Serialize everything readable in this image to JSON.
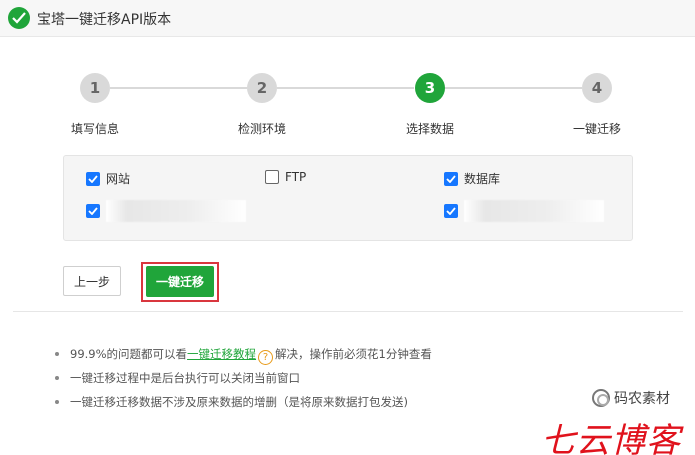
{
  "window": {
    "title": "宝塔一键迁移API版本"
  },
  "steps": [
    {
      "number": "1",
      "label": "填写信息",
      "state": "done"
    },
    {
      "number": "2",
      "label": "检测环境",
      "state": "done"
    },
    {
      "number": "3",
      "label": "选择数据",
      "state": "active"
    },
    {
      "number": "4",
      "label": "一键迁移",
      "state": "pending"
    }
  ],
  "options": {
    "site": {
      "label": "网站",
      "checked": true
    },
    "ftp": {
      "label": "FTP",
      "checked": false
    },
    "database": {
      "label": "数据库",
      "checked": true
    },
    "site_item": {
      "checked": true
    },
    "database_item": {
      "checked": true
    }
  },
  "buttons": {
    "prev": "上一步",
    "migrate": "一键迁移"
  },
  "notes": {
    "n1_before": "99.9%的问题都可以看",
    "n1_link": "一键迁移教程",
    "n1_after": "解决，操作前必须花1分钟查看",
    "n2": "一键迁移过程中是后台执行可以关闭当前窗口",
    "n3": "一键迁移迁移数据不涉及原来数据的增删（是将原来数据打包发送)"
  },
  "watermark": {
    "small": "码农素材",
    "big": "七云博客"
  },
  "colors": {
    "accent": "#20a53a",
    "checkbox": "#1677ff",
    "highlight": "#d9363e",
    "watermark": "#e0121c"
  },
  "icons": {
    "title": "check-circle-icon",
    "help": "question-circle-icon",
    "checkbox": "checkmark-icon"
  }
}
